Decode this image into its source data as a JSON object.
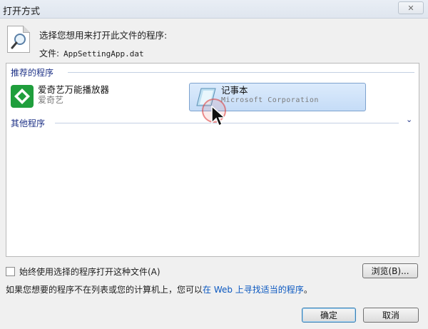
{
  "window": {
    "title": "打开方式",
    "close_label": "✕"
  },
  "header": {
    "prompt": "选择您想用来打开此文件的程序:",
    "file_label": "文件:",
    "file_name": "AppSettingApp.dat"
  },
  "recommended": {
    "label": "推荐的程序",
    "apps": [
      {
        "name": "爱奇艺万能播放器",
        "publisher": "爱奇艺"
      },
      {
        "name": "记事本",
        "publisher": "Microsoft Corporation"
      }
    ]
  },
  "other": {
    "label": "其他程序",
    "chevron": "⌄"
  },
  "footer": {
    "always_use_label": "始终使用选择的程序打开这种文件(A)",
    "browse_label": "浏览(B)...",
    "hint_prefix": "如果您想要的程序不在列表或您的计算机上，您可以",
    "hint_link": "在 Web 上寻找适当的程序",
    "hint_suffix": "。",
    "ok_label": "确定",
    "cancel_label": "取消"
  },
  "colors": {
    "group_header": "#1e3287",
    "selection": "#c5dcf7",
    "link": "#0b58c0"
  }
}
